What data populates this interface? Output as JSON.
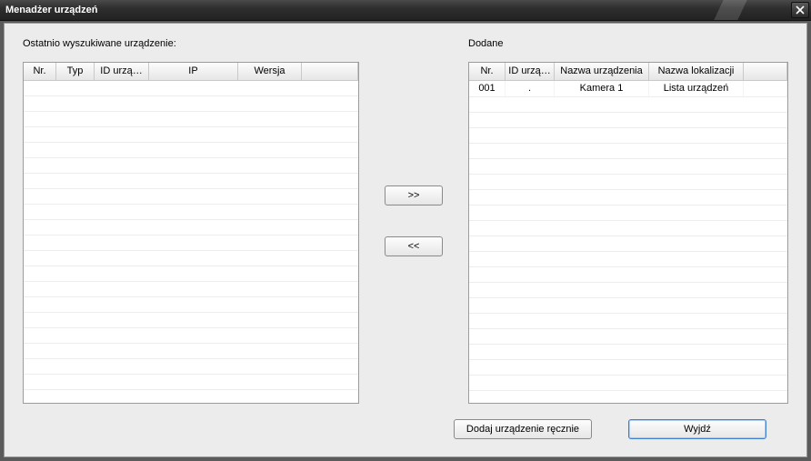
{
  "window": {
    "title": "Menadżer urządzeń"
  },
  "left": {
    "label": "Ostatnio wyszukiwane urządzenie:",
    "columns": {
      "nr": "Nr.",
      "type": "Typ",
      "device_id": "ID urzą…",
      "ip": "IP",
      "version": "Wersja"
    },
    "col_widths": {
      "nr": 36,
      "type": 42,
      "device_id": 60,
      "ip": 98,
      "version": 70
    },
    "rows": []
  },
  "right": {
    "label": "Dodane",
    "columns": {
      "nr": "Nr.",
      "device_id": "ID urzą…",
      "device_name": "Nazwa urządzenia",
      "location_name": "Nazwa lokalizacji"
    },
    "col_widths": {
      "nr": 40,
      "device_id": 54,
      "device_name": 104,
      "location_name": 104
    },
    "rows": [
      {
        "nr": "001",
        "device_id": ".",
        "device_name": "Kamera 1",
        "location_name": "Lista urządzeń"
      }
    ]
  },
  "transfer": {
    "add": ">>",
    "remove": "<<"
  },
  "footer": {
    "add_manual": "Dodaj urządzenie ręcznie",
    "exit": "Wyjdź"
  }
}
